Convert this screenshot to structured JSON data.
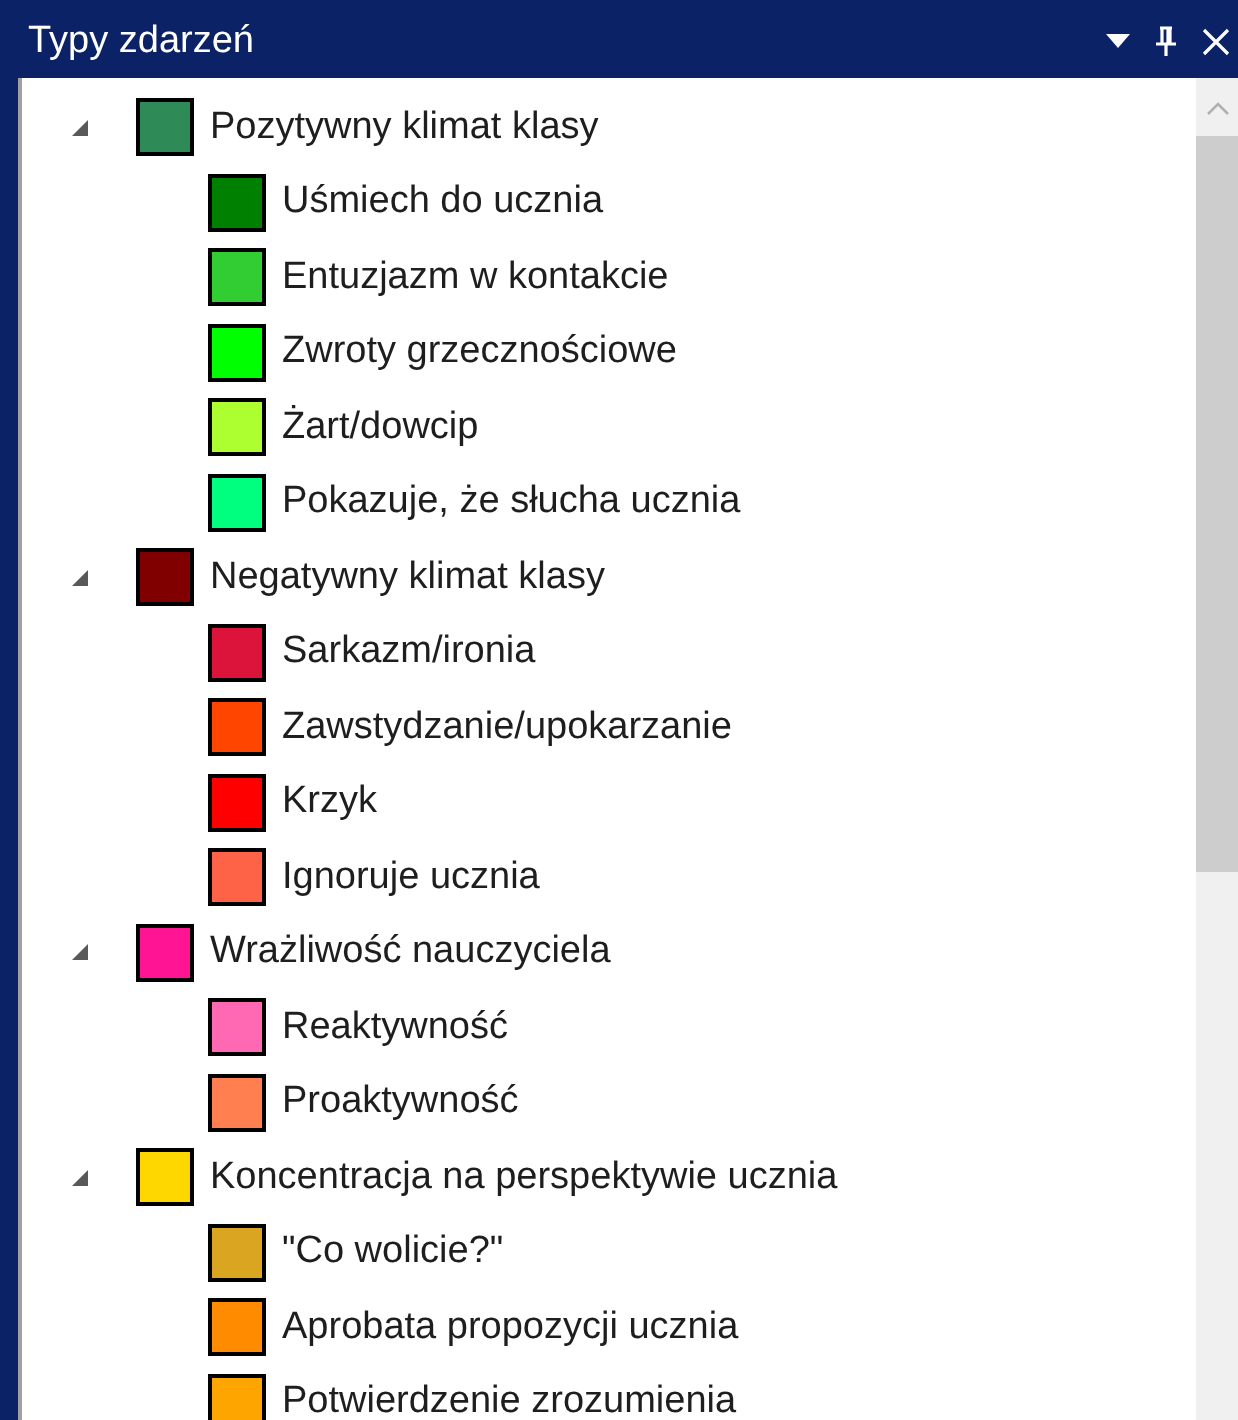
{
  "window": {
    "title": "Typy zdarzeń"
  },
  "tree": [
    {
      "label": "Pozytywny klimat klasy",
      "color": "#2e8b57",
      "expanded": true,
      "children": [
        {
          "label": "Uśmiech do ucznia",
          "color": "#008000"
        },
        {
          "label": "Entuzjazm w kontakcie",
          "color": "#32cd32"
        },
        {
          "label": "Zwroty grzecznościowe",
          "color": "#00ff00"
        },
        {
          "label": "Żart/dowcip",
          "color": "#adff2f"
        },
        {
          "label": "Pokazuje, że słucha ucznia",
          "color": "#00ff7f"
        }
      ]
    },
    {
      "label": "Negatywny klimat klasy",
      "color": "#800000",
      "expanded": true,
      "children": [
        {
          "label": "Sarkazm/ironia",
          "color": "#dc143c"
        },
        {
          "label": "Zawstydzanie/upokarzanie",
          "color": "#ff4500"
        },
        {
          "label": "Krzyk",
          "color": "#ff0000"
        },
        {
          "label": "Ignoruje ucznia",
          "color": "#ff6347"
        }
      ]
    },
    {
      "label": "Wrażliwość nauczyciela",
      "color": "#ff1493",
      "expanded": true,
      "children": [
        {
          "label": "Reaktywność",
          "color": "#ff69b4"
        },
        {
          "label": "Proaktywność",
          "color": "#ff7f50"
        }
      ]
    },
    {
      "label": "Koncentracja na perspektywie ucznia",
      "color": "#ffd700",
      "expanded": true,
      "children": [
        {
          "label": "\"Co wolicie?\"",
          "color": "#daa520"
        },
        {
          "label": "Aprobata propozycji ucznia",
          "color": "#ff8c00"
        },
        {
          "label": "Potwierdzenie zrozumienia",
          "color": "#ffa500"
        }
      ]
    }
  ]
}
